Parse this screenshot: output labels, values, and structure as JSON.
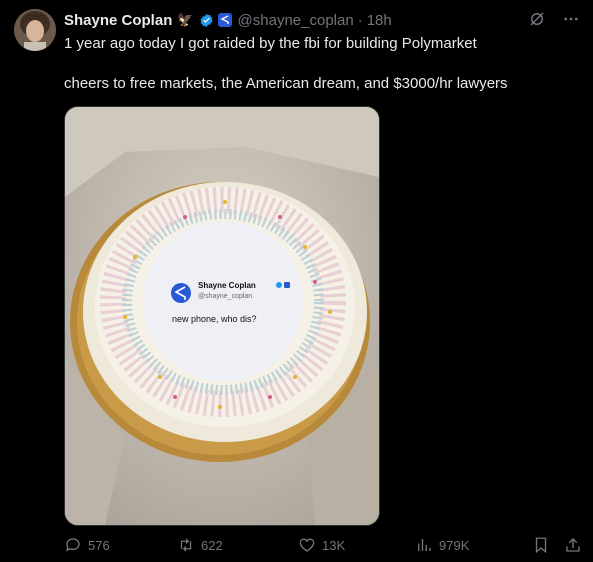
{
  "author": {
    "name": "Shayne Coplan",
    "handle": "@shayne_coplan",
    "separator": "·",
    "time": "18h",
    "emoji": "🦅"
  },
  "post": {
    "line1": "1 year ago today I got raided by the fbi for building Polymarket",
    "line2": "cheers to free markets, the American dream, and $3000/hr lawyers"
  },
  "media": {
    "card_name": "Shayne Coplan",
    "card_handle": "@shayne_coplan",
    "card_text": "new phone, who dis?"
  },
  "actions": {
    "replies": "576",
    "reposts": "622",
    "likes": "13K",
    "views": "979K"
  },
  "colors": {
    "background": "#000000",
    "text": "#e7e9ea",
    "muted": "#71767b",
    "verified": "#1d9bf0",
    "affiliation": "#2a59d6"
  },
  "icons": [
    "grok-icon",
    "more-icon",
    "reply-icon",
    "repost-icon",
    "like-icon",
    "views-icon",
    "bookmark-icon",
    "share-icon"
  ]
}
